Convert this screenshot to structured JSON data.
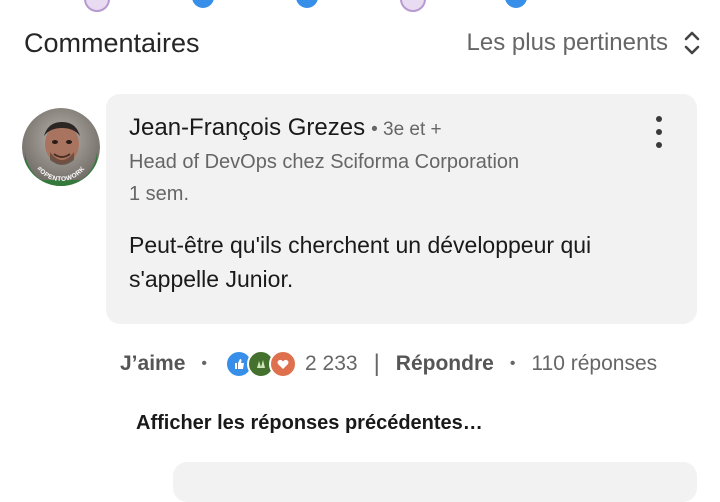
{
  "header": {
    "title": "Commentaires",
    "sort_label": "Les plus pertinents"
  },
  "comment": {
    "author": "Jean-François Grezes",
    "degree": "• 3e et +",
    "headline": "Head of DevOps chez Sciforma Corporation",
    "time": "1 sem.",
    "text": "Peut-être qu'ils cherchent un développeur qui s'appelle Junior.",
    "avatar_badge": "#OPENTOWORK",
    "actions": {
      "like_label": "J’aime",
      "reaction_count": "2 233",
      "reply_label": "Répondre",
      "replies_count": "110 réponses"
    }
  },
  "show_previous": "Afficher les réponses précédentes…",
  "colors": {
    "like_blue": "#378fe9",
    "celebrate_green": "#44712e",
    "love_red": "#df704d",
    "opentowork_green": "#2f7a3a",
    "bubble_bg": "#f2f2f2"
  },
  "icons": [
    "sort-icon",
    "more-options-icon",
    "like-reaction-icon",
    "celebrate-reaction-icon",
    "love-reaction-icon"
  ]
}
